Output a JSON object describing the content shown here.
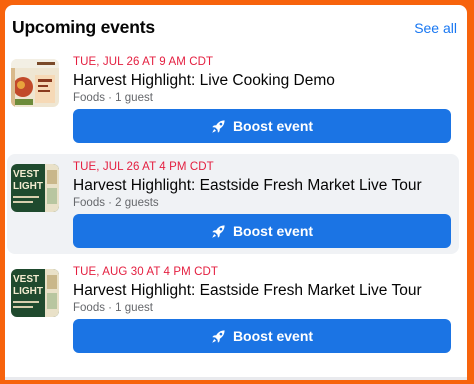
{
  "header": {
    "title": "Upcoming events",
    "see_all": "See all"
  },
  "events": [
    {
      "date": "TUE, JUL 26 AT 9 AM CDT",
      "name": "Harvest Highlight: Live Cooking Demo",
      "meta": "Foods · 1 guest",
      "boost_label": "Boost event",
      "thumb_icon": "cooking-demo-thumbnail"
    },
    {
      "date": "TUE, JUL 26 AT 4 PM CDT",
      "name": "Harvest Highlight: Eastside Fresh Market Live Tour",
      "meta": "Foods · 2 guests",
      "boost_label": "Boost event",
      "thumb_icon": "market-tour-thumbnail",
      "thumb_text_1": "VEST",
      "thumb_text_2": "LIGHT"
    },
    {
      "date": "TUE, AUG 30 AT 4 PM CDT",
      "name": "Harvest Highlight: Eastside Fresh Market Live Tour",
      "meta": "Foods · 1 guest",
      "boost_label": "Boost event",
      "thumb_icon": "market-tour-thumbnail",
      "thumb_text_1": "VEST",
      "thumb_text_2": "LIGHT"
    }
  ],
  "colors": {
    "accent": "#1b74e4",
    "date": "#e41e3f",
    "frame": "#f7630c"
  }
}
